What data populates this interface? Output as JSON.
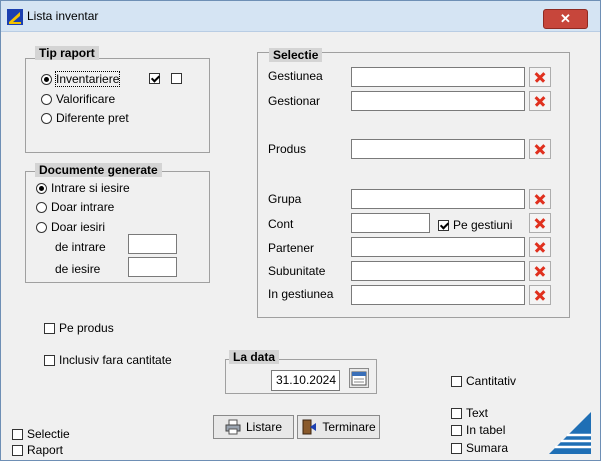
{
  "window": {
    "title": "Lista inventar",
    "close_glyph": "✕"
  },
  "tip_raport": {
    "legend": "Tip raport",
    "options": [
      "Inventariere",
      "Valorificare",
      "Diferente pret"
    ],
    "selected": 0
  },
  "documente": {
    "legend": "Documente generate",
    "options": [
      "Intrare si iesire",
      "Doar intrare",
      "Doar iesiri"
    ],
    "selected": 0,
    "de_intrare_label": "de intrare",
    "de_iesire_label": "de iesire",
    "de_intrare_value": "",
    "de_iesire_value": ""
  },
  "selectie": {
    "legend": "Selectie",
    "fields": {
      "gestiunea": "Gestiunea",
      "gestionar": "Gestionar",
      "produs": "Produs",
      "grupa": "Grupa",
      "cont": "Cont",
      "partener": "Partener",
      "subunitate": "Subunitate",
      "in_gestiunea": "In gestiunea"
    },
    "pe_gestiuni_label": "Pe gestiuni",
    "pe_gestiuni_checked": true
  },
  "options": {
    "pe_produs": "Pe produs",
    "inclusiv": "Inclusiv fara cantitate",
    "cantitativ": "Cantitativ",
    "text": "Text",
    "in_tabel": "In tabel",
    "sumara": "Sumara",
    "selectie": "Selectie",
    "raport": "Raport"
  },
  "la_data": {
    "legend": "La data",
    "value": "31.10.2024"
  },
  "buttons": {
    "listare": "Listare",
    "terminare": "Terminare"
  },
  "colors": {
    "title_bar": "#d5e4f3",
    "close": "#c7463b",
    "x_red": "#e0301e",
    "logo_blue": "#1f6fb5"
  }
}
